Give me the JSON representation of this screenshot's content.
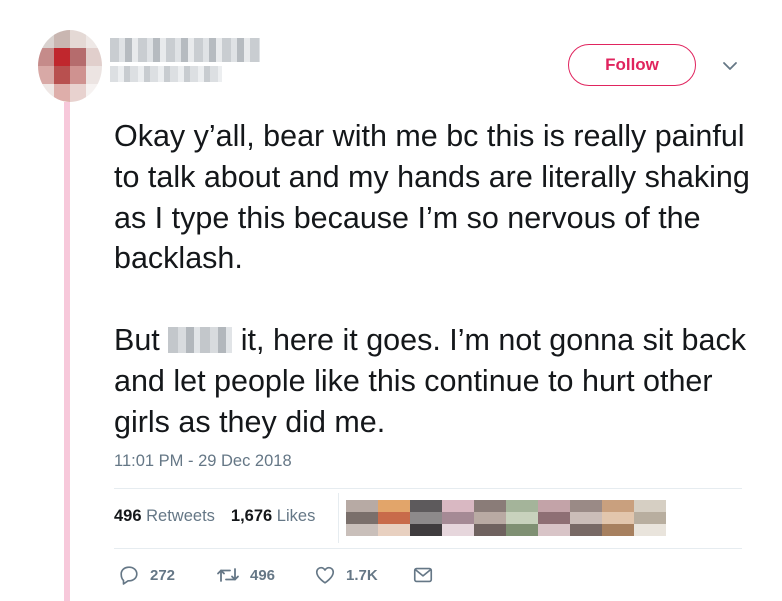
{
  "header": {
    "follow_label": "Follow"
  },
  "tweet": {
    "line1": "Okay y’all, bear with me bc this is really painful to talk about and my hands are literally shaking as I type this because I’m so nervous of the backlash.",
    "line2_before": "But",
    "line2_after": "it, here it goes. I’m not gonna sit back and let people like this continue to hurt other girls as they did me.",
    "timestamp": "11:01 PM - 29 Dec 2018"
  },
  "stats": {
    "retweets_count": "496",
    "retweets_label": "Retweets",
    "likes_count": "1,676",
    "likes_label": "Likes"
  },
  "actions": {
    "replies": "272",
    "retweets": "496",
    "likes": "1.7K"
  },
  "colors": {
    "accent": "#e0245e",
    "thread_line": "#f7c8da",
    "muted": "#657786",
    "text": "#14171a"
  },
  "icons": [
    "reply-icon",
    "retweet-icon",
    "heart-icon",
    "message-icon",
    "chevron-down-icon"
  ]
}
